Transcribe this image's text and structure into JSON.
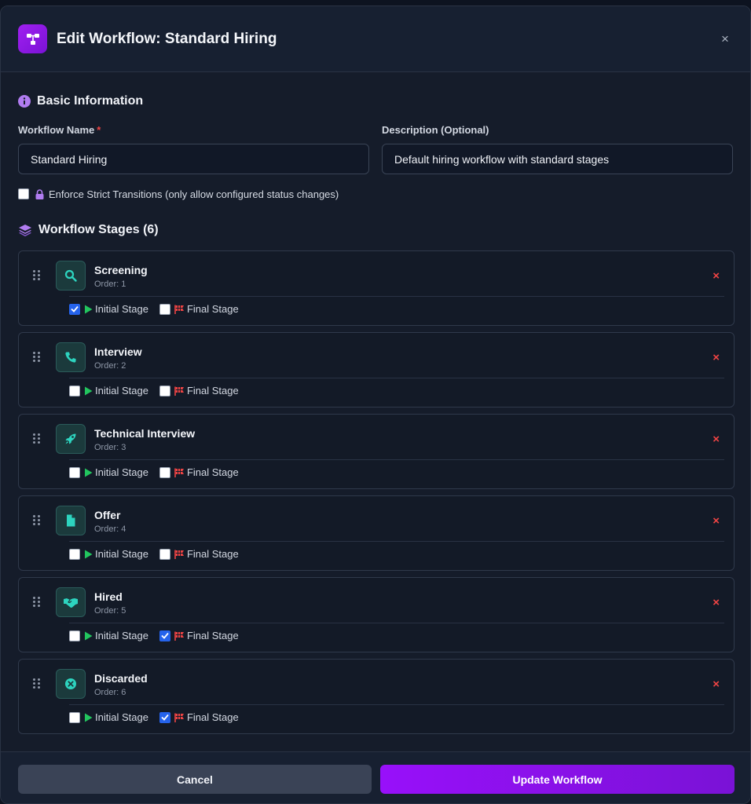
{
  "header": {
    "title": "Edit Workflow: Standard Hiring",
    "close_label": "×"
  },
  "basic": {
    "title": "Basic Information",
    "name_label": "Workflow Name",
    "required_mark": "*",
    "name_value": "Standard Hiring",
    "desc_label": "Description (Optional)",
    "desc_value": "Default hiring workflow with standard stages",
    "enforce_checked": false,
    "enforce_label": "Enforce Strict Transitions (only allow configured status changes)"
  },
  "stages_section": {
    "title": "Workflow Stages (6)"
  },
  "stage_labels": {
    "initial": "Initial Stage",
    "final": "Final Stage",
    "remove": "×"
  },
  "stages": [
    {
      "name": "Screening",
      "order": "Order: 1",
      "icon": "search-icon",
      "initial": true,
      "final": false
    },
    {
      "name": "Interview",
      "order": "Order: 2",
      "icon": "phone-icon",
      "initial": false,
      "final": false
    },
    {
      "name": "Technical Interview",
      "order": "Order: 3",
      "icon": "rocket-icon",
      "initial": false,
      "final": false
    },
    {
      "name": "Offer",
      "order": "Order: 4",
      "icon": "document-icon",
      "initial": false,
      "final": false
    },
    {
      "name": "Hired",
      "order": "Order: 5",
      "icon": "handshake-icon",
      "initial": false,
      "final": true
    },
    {
      "name": "Discarded",
      "order": "Order: 6",
      "icon": "x-circle-icon",
      "initial": false,
      "final": true
    }
  ],
  "footer": {
    "cancel_label": "Cancel",
    "update_label": "Update Workflow"
  },
  "colors": {
    "accent": "#9810fa",
    "stage_icon": "#2dd4bf",
    "remove": "#ef4444",
    "initial_icon": "#22c55e",
    "final_icon": "#ef4444",
    "checkbox_checked": "#2563eb"
  }
}
